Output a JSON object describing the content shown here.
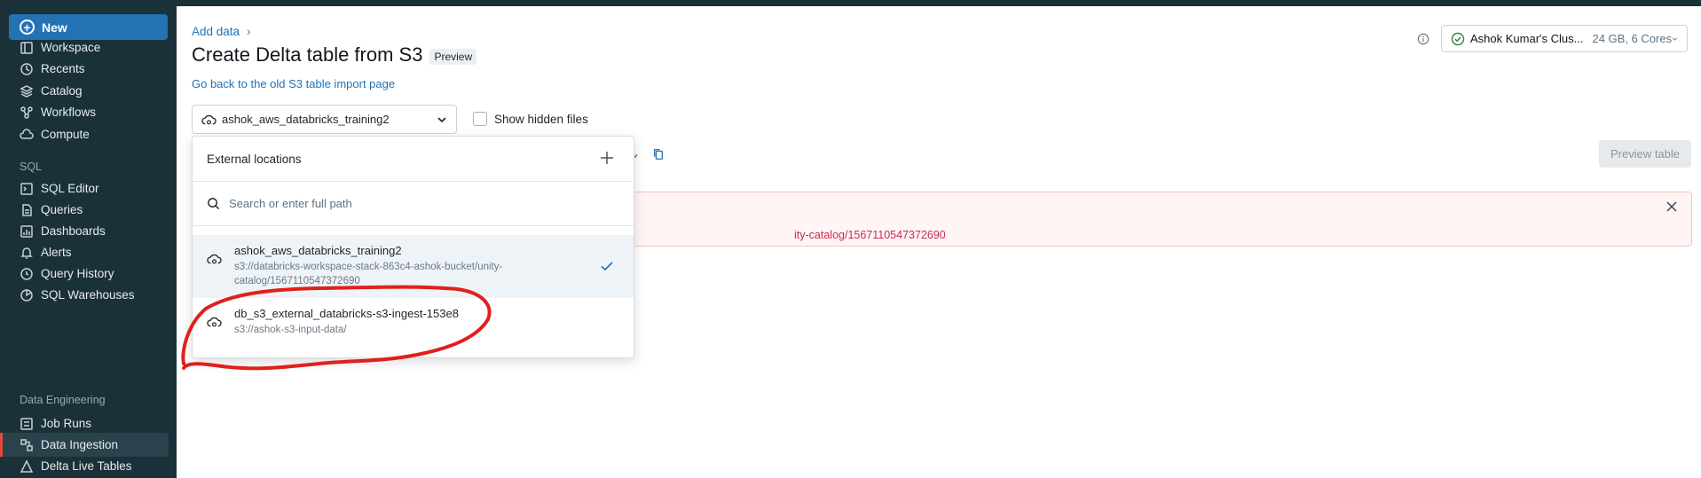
{
  "sidebar": {
    "new_label": "New",
    "items": [
      {
        "label": "Workspace",
        "icon": "workspace-icon"
      },
      {
        "label": "Recents",
        "icon": "clock-icon"
      },
      {
        "label": "Catalog",
        "icon": "catalog-icon"
      },
      {
        "label": "Workflows",
        "icon": "workflows-icon"
      },
      {
        "label": "Compute",
        "icon": "cloud-icon"
      }
    ],
    "sql_section": "SQL",
    "sql_items": [
      {
        "label": "SQL Editor",
        "icon": "editor-icon"
      },
      {
        "label": "Queries",
        "icon": "queries-icon"
      },
      {
        "label": "Dashboards",
        "icon": "dashboard-icon"
      },
      {
        "label": "Alerts",
        "icon": "bell-icon"
      },
      {
        "label": "Query History",
        "icon": "history-icon"
      },
      {
        "label": "SQL Warehouses",
        "icon": "warehouse-icon"
      }
    ],
    "de_section": "Data Engineering",
    "de_items": [
      {
        "label": "Job Runs",
        "icon": "job-runs-icon"
      },
      {
        "label": "Data Ingestion",
        "icon": "ingestion-icon",
        "active": true
      },
      {
        "label": "Delta Live Tables",
        "icon": "pipeline-icon"
      }
    ]
  },
  "header": {
    "breadcrumb": "Add data",
    "title": "Create Delta table from S3",
    "tag": "Preview",
    "back_link": "Go back to the old S3 table import page"
  },
  "cluster": {
    "name": "Ashok Kumar's Clus...",
    "spec": "24 GB, 6 Cores"
  },
  "location_select": {
    "value": "ashok_aws_databricks_training2"
  },
  "hidden_files_label": "Show hidden files",
  "preview_button": "Preview table",
  "error": {
    "text_visible": "ity-catalog/1567110547372690"
  },
  "dropdown": {
    "header": "External locations",
    "search_placeholder": "Search or enter full path",
    "items": [
      {
        "name": "ashok_aws_databricks_training2",
        "path": "s3://databricks-workspace-stack-863c4-ashok-bucket/unity-catalog/1567110547372690",
        "selected": true
      },
      {
        "name": "db_s3_external_databricks-s3-ingest-153e8",
        "path": "s3://ashok-s3-input-data/",
        "selected": false
      }
    ]
  },
  "colors": {
    "sidebar_bg": "#1b3139",
    "accent": "#2272b4",
    "error": "#c82d4c",
    "annotation": "#e0201b"
  }
}
